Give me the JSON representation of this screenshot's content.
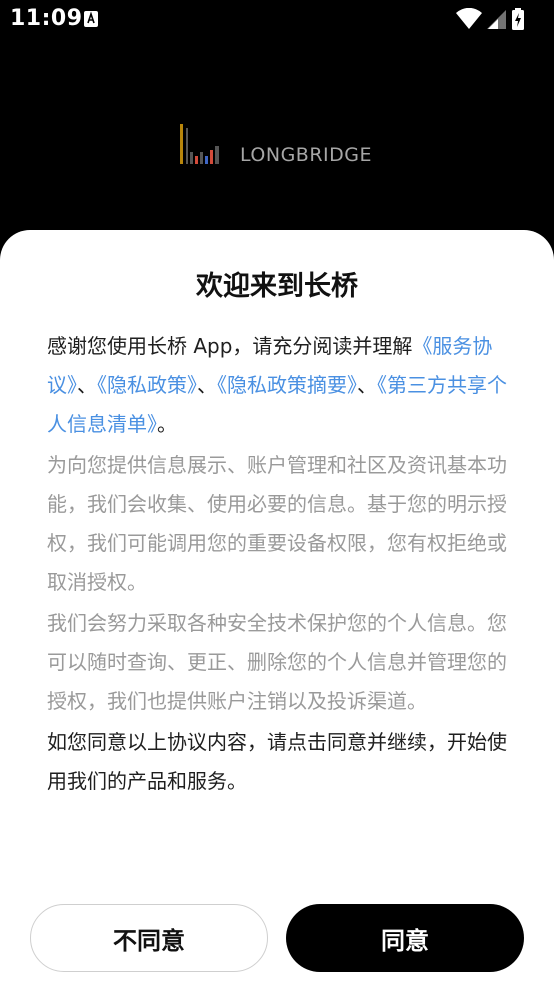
{
  "status_bar": {
    "time": "11:09"
  },
  "logo": {
    "text": "LONGBRIDGE"
  },
  "dialog": {
    "title": "欢迎来到长桥",
    "intro": {
      "prefix": "感谢您使用长桥 App，请充分阅读并理解",
      "link_service": "《服务协议》",
      "sep1": "、",
      "link_privacy": "《隐私政策》",
      "sep2": "、",
      "link_privacy_summary": "《隐私政策摘要》",
      "sep3": "、",
      "link_third_party": "《第三方共享个人信息清单》",
      "suffix": "。"
    },
    "para2": "为向您提供信息展示、账户管理和社区及资讯基本功能，我们会收集、使用必要的信息。基于您的明示授权，我们可能调用您的重要设备权限，您有权拒绝或取消授权。",
    "para3": "我们会努力采取各种安全技术保护您的个人信息。您可以随时查询、更正、删除您的个人信息并管理您的授权，我们也提供账户注销以及投诉渠道。",
    "para4": "如您同意以上协议内容，请点击同意并继续，开始使用我们的产品和服务。",
    "disagree_label": "不同意",
    "agree_label": "同意"
  },
  "colors": {
    "link": "#4a90e2",
    "primary_button": "#000000",
    "secondary_text": "#9a9a9a"
  }
}
